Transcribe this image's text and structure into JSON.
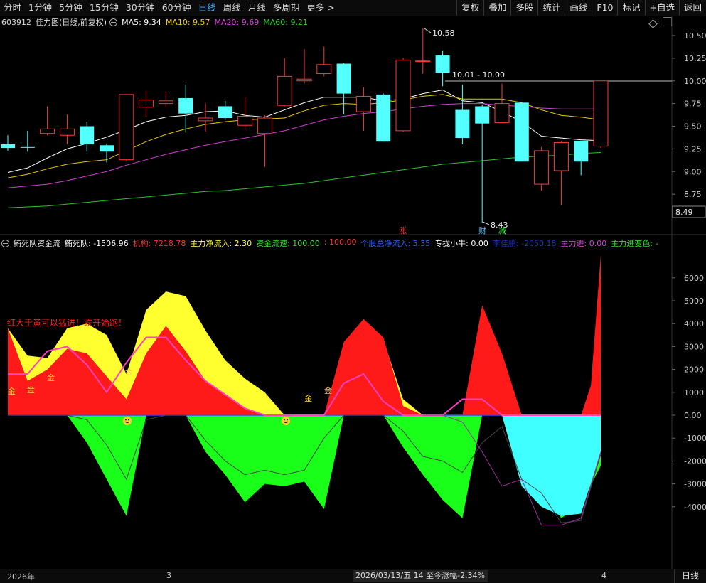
{
  "toolbar": {
    "periods": [
      "分时",
      "1分钟",
      "5分钟",
      "15分钟",
      "30分钟",
      "60分钟",
      "日线",
      "周线",
      "月线",
      "多周期",
      "更多 >"
    ],
    "active_period": "日线",
    "buttons": [
      "复权",
      "叠加",
      "多股",
      "统计",
      "画线",
      "F10",
      "标记",
      "+自选",
      "返回"
    ]
  },
  "main_panel": {
    "code": "603912",
    "title": "佳力图(日线,前复权)",
    "ma": [
      {
        "label": "MA5: 9.34",
        "color": "#ffffff"
      },
      {
        "label": "MA10: 9.57",
        "color": "#f0d000"
      },
      {
        "label": "MA20: 9.69",
        "color": "#e040e0"
      },
      {
        "label": "MA60: 9.21",
        "color": "#30d030"
      }
    ],
    "price_axis": [
      "10.50",
      "10.25",
      "10.00",
      "9.75",
      "9.50",
      "9.25",
      "9.00",
      "8.75",
      "8.50"
    ],
    "current_price_tag": "8.49",
    "high_label": "10.58",
    "low_label": "8.43",
    "line_label": "10.01 - 10.00",
    "markers": [
      "涨",
      "财",
      "减"
    ]
  },
  "indicator_panel": {
    "name": "鲔死队资金流",
    "readouts": [
      {
        "text": "鲔死队: -1506.96",
        "color": "#ffffff"
      },
      {
        "text": "机构: 7218.78",
        "color": "#ff3030"
      },
      {
        "text": "主力净流入: 2.30",
        "color": "#ffff40"
      },
      {
        "text": "资金流速: 100.00",
        "color": "#30e030"
      },
      {
        "text": ": 100.00",
        "color": "#ff3030"
      },
      {
        "text": "个股总净流入: 5.35",
        "color": "#3060ff"
      },
      {
        "text": "专拢小牛: 0.00",
        "color": "#ffffff"
      },
      {
        "text": "李佳鹏: -2050.18",
        "color": "#2030c0"
      },
      {
        "text": "主力进: 0.00",
        "color": "#e040e0"
      },
      {
        "text": "主力进变色: -",
        "color": "#30e030"
      }
    ],
    "axis": [
      "6000",
      "5000",
      "4000",
      "3000",
      "2000",
      "1000",
      "0.00",
      "-1000",
      "-2000",
      "-3000",
      "-4000"
    ],
    "banner": "红大于黄可以猛进！跌开始跑！",
    "gold_label": "金"
  },
  "footer": {
    "year": "2026年",
    "month_3": "3",
    "month_4": "4",
    "date_info": "2026/03/13/五 14 至今涨幅-2.34%",
    "period": "日线"
  },
  "candles": [
    {
      "o": 9.3,
      "h": 9.4,
      "l": 9.23,
      "c": 9.26,
      "bull": false
    },
    {
      "o": 9.27,
      "h": 9.45,
      "l": 9.22,
      "c": 9.27,
      "bull": false
    },
    {
      "o": 9.42,
      "h": 9.72,
      "l": 9.4,
      "c": 9.47,
      "bull": true
    },
    {
      "o": 9.4,
      "h": 9.63,
      "l": 9.3,
      "c": 9.47,
      "bull": true
    },
    {
      "o": 9.5,
      "h": 9.55,
      "l": 9.22,
      "c": 9.3,
      "bull": false
    },
    {
      "o": 9.22,
      "h": 9.31,
      "l": 9.1,
      "c": 9.29,
      "bull": false
    },
    {
      "o": 9.13,
      "h": 9.85,
      "l": 9.12,
      "c": 9.85,
      "bull": true
    },
    {
      "o": 9.71,
      "h": 9.89,
      "l": 9.6,
      "c": 9.79,
      "bull": true
    },
    {
      "o": 9.75,
      "h": 9.88,
      "l": 9.71,
      "c": 9.78,
      "bull": true
    },
    {
      "o": 9.81,
      "h": 9.96,
      "l": 9.43,
      "c": 9.64,
      "bull": false
    },
    {
      "o": 9.56,
      "h": 9.75,
      "l": 9.44,
      "c": 9.59,
      "bull": true
    },
    {
      "o": 9.72,
      "h": 9.78,
      "l": 9.57,
      "c": 9.59,
      "bull": false
    },
    {
      "o": 9.51,
      "h": 9.82,
      "l": 9.46,
      "c": 9.61,
      "bull": true
    },
    {
      "o": 9.42,
      "h": 9.62,
      "l": 9.05,
      "c": 9.59,
      "bull": true
    },
    {
      "o": 9.73,
      "h": 10.25,
      "l": 9.72,
      "c": 10.05,
      "bull": true
    },
    {
      "o": 10.0,
      "h": 10.35,
      "l": 9.97,
      "c": 10.02,
      "bull": true
    },
    {
      "o": 10.08,
      "h": 10.38,
      "l": 10.05,
      "c": 10.18,
      "bull": true
    },
    {
      "o": 10.19,
      "h": 10.2,
      "l": 9.63,
      "c": 9.86,
      "bull": false
    },
    {
      "o": 9.83,
      "h": 9.93,
      "l": 9.45,
      "c": 9.66,
      "bull": true
    },
    {
      "o": 9.85,
      "h": 9.86,
      "l": 9.33,
      "c": 9.33,
      "bull": false
    },
    {
      "o": 9.45,
      "h": 10.25,
      "l": 9.44,
      "c": 10.23,
      "bull": true
    },
    {
      "o": 10.22,
      "h": 10.58,
      "l": 10.08,
      "c": 10.22,
      "bull": true
    },
    {
      "o": 10.28,
      "h": 10.33,
      "l": 9.94,
      "c": 10.09,
      "bull": false
    },
    {
      "o": 9.68,
      "h": 9.96,
      "l": 9.3,
      "c": 9.37,
      "bull": false
    },
    {
      "o": 9.72,
      "h": 9.74,
      "l": 8.43,
      "c": 9.53,
      "bull": false
    },
    {
      "o": 9.54,
      "h": 9.97,
      "l": 9.54,
      "c": 9.75,
      "bull": true
    },
    {
      "o": 9.76,
      "h": 9.76,
      "l": 9.11,
      "c": 9.11,
      "bull": false
    },
    {
      "o": 8.86,
      "h": 9.27,
      "l": 8.79,
      "c": 9.23,
      "bull": true
    },
    {
      "o": 9.01,
      "h": 9.33,
      "l": 8.63,
      "c": 9.32,
      "bull": true
    },
    {
      "o": 9.34,
      "h": 9.34,
      "l": 8.96,
      "c": 9.11,
      "bull": false
    },
    {
      "o": 9.28,
      "h": 10.0,
      "l": 9.26,
      "c": 10.0,
      "bull": true
    }
  ],
  "ma_series": {
    "ma5": [
      8.99,
      9.04,
      9.15,
      9.25,
      9.31,
      9.38,
      9.46,
      9.55,
      9.6,
      9.62,
      9.66,
      9.67,
      9.62,
      9.6,
      9.68,
      9.76,
      9.82,
      9.82,
      9.82,
      9.78,
      9.8,
      9.86,
      9.9,
      9.78,
      9.76,
      9.66,
      9.55,
      9.39,
      9.37,
      9.35,
      9.34
    ],
    "ma10": [
      8.93,
      8.97,
      9.03,
      9.08,
      9.11,
      9.13,
      9.23,
      9.33,
      9.41,
      9.47,
      9.52,
      9.55,
      9.57,
      9.58,
      9.59,
      9.67,
      9.73,
      9.75,
      9.74,
      9.76,
      9.79,
      9.83,
      9.85,
      9.8,
      9.8,
      9.8,
      9.76,
      9.68,
      9.62,
      9.6,
      9.57
    ],
    "ma20": [
      8.82,
      8.84,
      8.86,
      8.9,
      8.95,
      9.0,
      9.07,
      9.13,
      9.19,
      9.24,
      9.29,
      9.33,
      9.37,
      9.41,
      9.45,
      9.51,
      9.57,
      9.61,
      9.64,
      9.66,
      9.69,
      9.72,
      9.74,
      9.75,
      9.75,
      9.73,
      9.72,
      9.7,
      9.69,
      9.69,
      9.69
    ],
    "ma60": [
      8.6,
      8.61,
      8.62,
      8.64,
      8.66,
      8.68,
      8.7,
      8.72,
      8.74,
      8.76,
      8.78,
      8.79,
      8.81,
      8.83,
      8.85,
      8.87,
      8.9,
      8.93,
      8.96,
      8.99,
      9.02,
      9.05,
      9.08,
      9.1,
      9.12,
      9.14,
      9.16,
      9.17,
      9.18,
      9.2,
      9.21
    ]
  },
  "flow_series": {
    "yellow": [
      3800,
      2600,
      2500,
      3800,
      4000,
      3500,
      1800,
      4600,
      5400,
      5200,
      3700,
      2400,
      1600,
      1000,
      0,
      0,
      -400,
      2900,
      4200,
      3300,
      700,
      0,
      0,
      0,
      200,
      0,
      0,
      0,
      0,
      0,
      0
    ],
    "red": [
      3800,
      1500,
      2000,
      2900,
      2700,
      1700,
      700,
      2700,
      3900,
      2800,
      1500,
      900,
      300,
      0,
      0,
      0,
      0,
      3200,
      4200,
      3400,
      400,
      0,
      0,
      0,
      4800,
      2700,
      0,
      0,
      0,
      0,
      1200
    ],
    "green": [
      0,
      0,
      0,
      0,
      -1200,
      -2800,
      -4400,
      0,
      0,
      0,
      -1600,
      -2600,
      -3800,
      -3000,
      -3100,
      -2900,
      -4100,
      0,
      0,
      0,
      -1400,
      -2600,
      -3700,
      -4500,
      0,
      0,
      -1200,
      -3000,
      -4500,
      -3900,
      -2200
    ],
    "cyan": [
      0,
      0,
      0,
      0,
      0,
      0,
      0,
      0,
      0,
      0,
      0,
      0,
      0,
      0,
      0,
      0,
      0,
      0,
      0,
      0,
      0,
      0,
      0,
      0,
      0,
      0,
      -3100,
      -4000,
      -4400,
      -4300,
      -1600
    ],
    "magenta": [
      1800,
      1800,
      2800,
      3000,
      2200,
      1000,
      2300,
      3400,
      3400,
      2400,
      1500,
      900,
      300,
      0,
      0,
      0,
      0,
      1400,
      1800,
      600,
      0,
      0,
      0,
      700,
      700,
      0,
      0,
      0,
      0,
      0,
      0
    ]
  }
}
